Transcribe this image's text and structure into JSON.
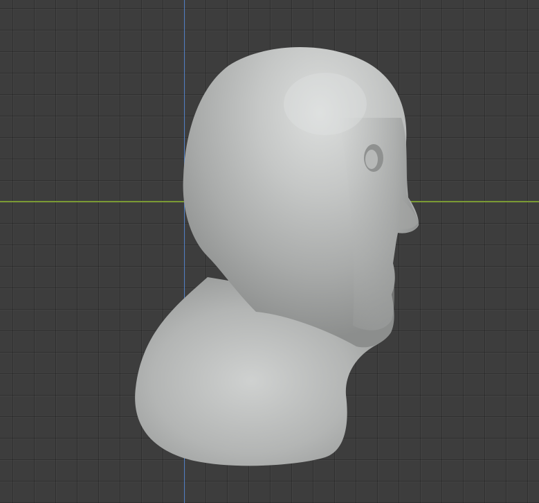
{
  "viewport": {
    "background_color": "#3d3d3d",
    "grid_color": "#2f2f2f",
    "axis_colors": {
      "y_axis": "#4f7ec3",
      "x_axis": "#7b9a34"
    }
  },
  "object": {
    "kind": "sculpted-head-mesh",
    "view": "side",
    "material_color": "#bdbfbe"
  }
}
